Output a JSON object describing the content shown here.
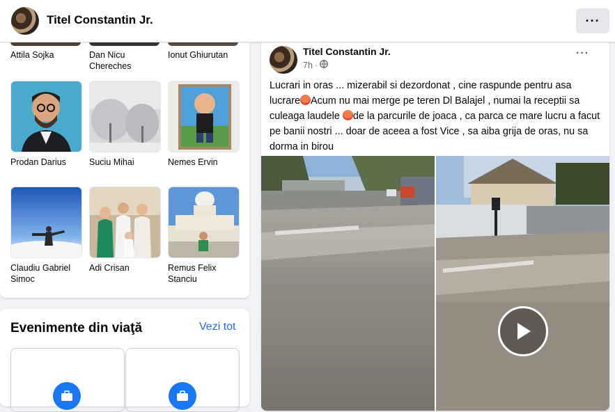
{
  "header": {
    "profile_name": "Titel Constantin Jr.",
    "more_label": "···"
  },
  "friends": {
    "top_row": [
      {
        "name": "Attila Sojka"
      },
      {
        "name": "Dan Nicu Chereches"
      },
      {
        "name": "Ionut Ghiurutan"
      }
    ],
    "items": [
      {
        "name": "Prodan Darius"
      },
      {
        "name": "Suciu Mihai"
      },
      {
        "name": "Nemes Ervin"
      },
      {
        "name": "Claudiu Gabriel Simoc"
      },
      {
        "name": "Adi Crisan"
      },
      {
        "name": "Remus Felix Stanciu"
      }
    ]
  },
  "events": {
    "title": "Evenimente din viaţă",
    "see_all": "Vezi tot"
  },
  "post": {
    "author": "Titel Constantin Jr.",
    "time": "7h",
    "separator": "·",
    "more_label": "···",
    "text_part1": "Lucrari in oras ... mizerabil si dezordonat , cine raspunde pentru asa lucrare",
    "text_part2": "Acum nu mai merge pe teren Dl Balajel , numai la receptii sa culeaga laudele ",
    "text_part3": "de la parcurile de joaca , ca parca ce mare lucru a facut pe banii nostri ... doar de aceea a fost Vice , sa aiba grija de oras, nu sa dorma  in birou",
    "emoji": "angry-face-emoji",
    "privacy_icon": "globe-icon",
    "media_action_icon": "play-icon"
  }
}
